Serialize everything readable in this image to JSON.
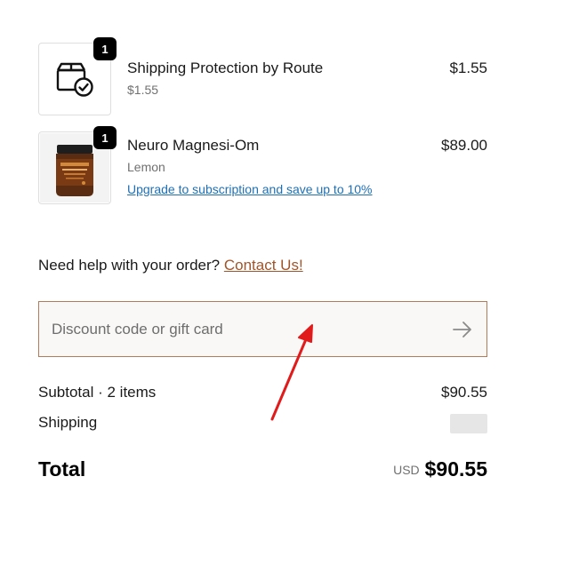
{
  "cart": {
    "items": [
      {
        "title": "Shipping Protection by Route",
        "subtitle": "$1.55",
        "price": "$1.55",
        "quantity": "1",
        "icon": "package-check-icon"
      },
      {
        "title": "Neuro Magnesi-Om",
        "subtitle": "Lemon",
        "price": "$89.00",
        "quantity": "1",
        "upgrade_link": "Upgrade to subscription and save up to 10%"
      }
    ]
  },
  "help": {
    "text": "Need help with your order?",
    "link": "Contact Us!"
  },
  "discount": {
    "placeholder": "Discount code or gift card",
    "value": ""
  },
  "summary": {
    "subtotal_label": "Subtotal · 2 items",
    "subtotal_value": "$90.55",
    "shipping_label": "Shipping",
    "total_label": "Total",
    "currency": "USD",
    "total_value": "$90.55"
  },
  "colors": {
    "annotation_arrow": "#e11b1b",
    "link": "#1f6fb5",
    "contact_link": "#a0552a",
    "discount_border": "#b07b5a"
  }
}
